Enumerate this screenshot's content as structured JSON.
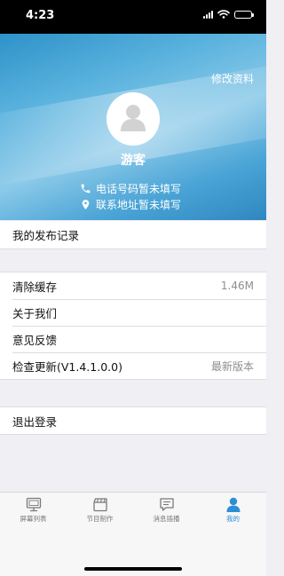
{
  "status_bar": {
    "time": "4:23"
  },
  "header": {
    "edit_label": "修改资料",
    "username": "游客",
    "phone_text": "电话号码暂未填写",
    "address_text": "联系地址暂未填写"
  },
  "menu": {
    "publish_records": "我的发布记录",
    "clear_cache": {
      "label": "清除缓存",
      "value": "1.46M"
    },
    "about": "关于我们",
    "feedback": "意见反馈",
    "check_update": {
      "label": "检查更新(V1.4.1.0.0)",
      "value": "最新版本"
    },
    "logout": "退出登录"
  },
  "tabbar": {
    "items": [
      {
        "label": "屏幕列表",
        "icon": "monitor-icon"
      },
      {
        "label": "节目制作",
        "icon": "clapperboard-icon"
      },
      {
        "label": "消息插播",
        "icon": "message-icon"
      },
      {
        "label": "我的",
        "icon": "person-icon"
      }
    ],
    "active_color": "#2b8fd6"
  },
  "colors": {
    "header_blue": "#3a9bd2",
    "accent": "#2b8fd6"
  }
}
